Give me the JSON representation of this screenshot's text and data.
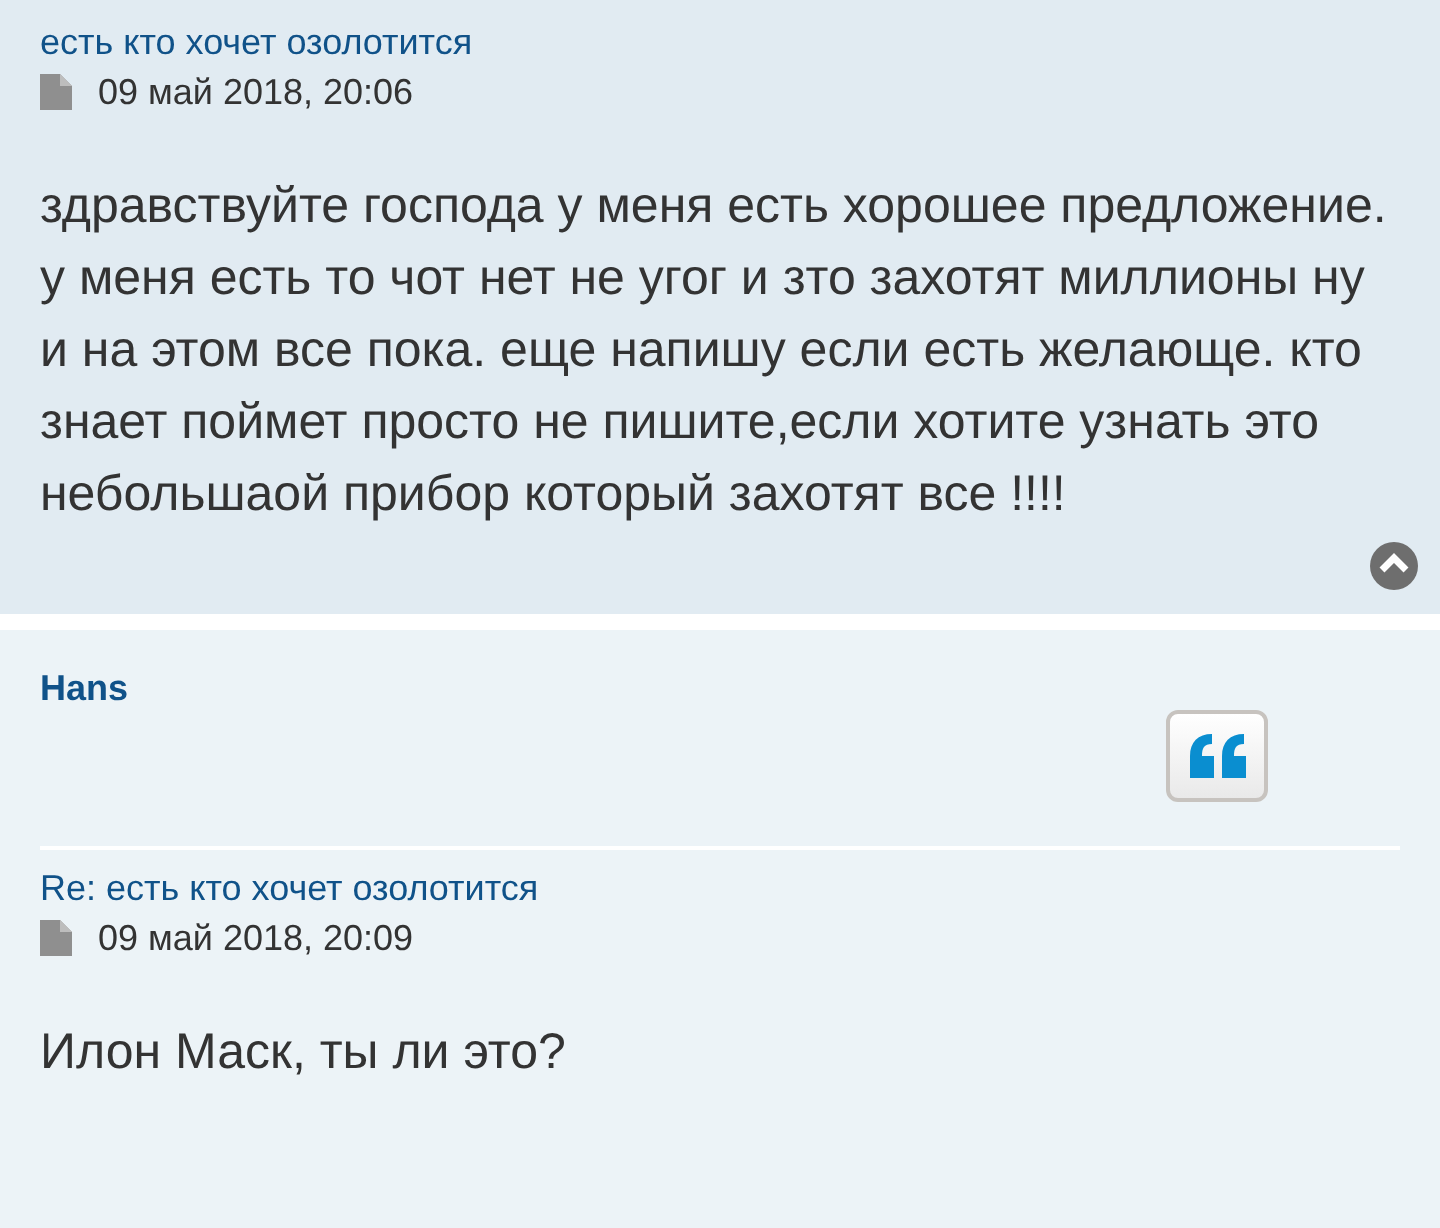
{
  "posts": [
    {
      "title": "есть кто хочет озолотится",
      "date": "09 май 2018, 20:06",
      "body": "здравствуйте господа у меня есть хорошее предложение. у меня есть то чот нет не угог и зто захотят миллионы ну и на этом все пока. еще напишу если есть желающе. кто знает поймет просто не пишите,если хотите узнать это небольшаой прибор который захотят все !!!!",
      "back_to_top": true
    },
    {
      "author": "Hans",
      "title": "Re: есть кто хочет озолотится",
      "date": "09 май 2018, 20:09",
      "body": "Илон Маск, ты ли это?",
      "back_to_top": false
    }
  ]
}
